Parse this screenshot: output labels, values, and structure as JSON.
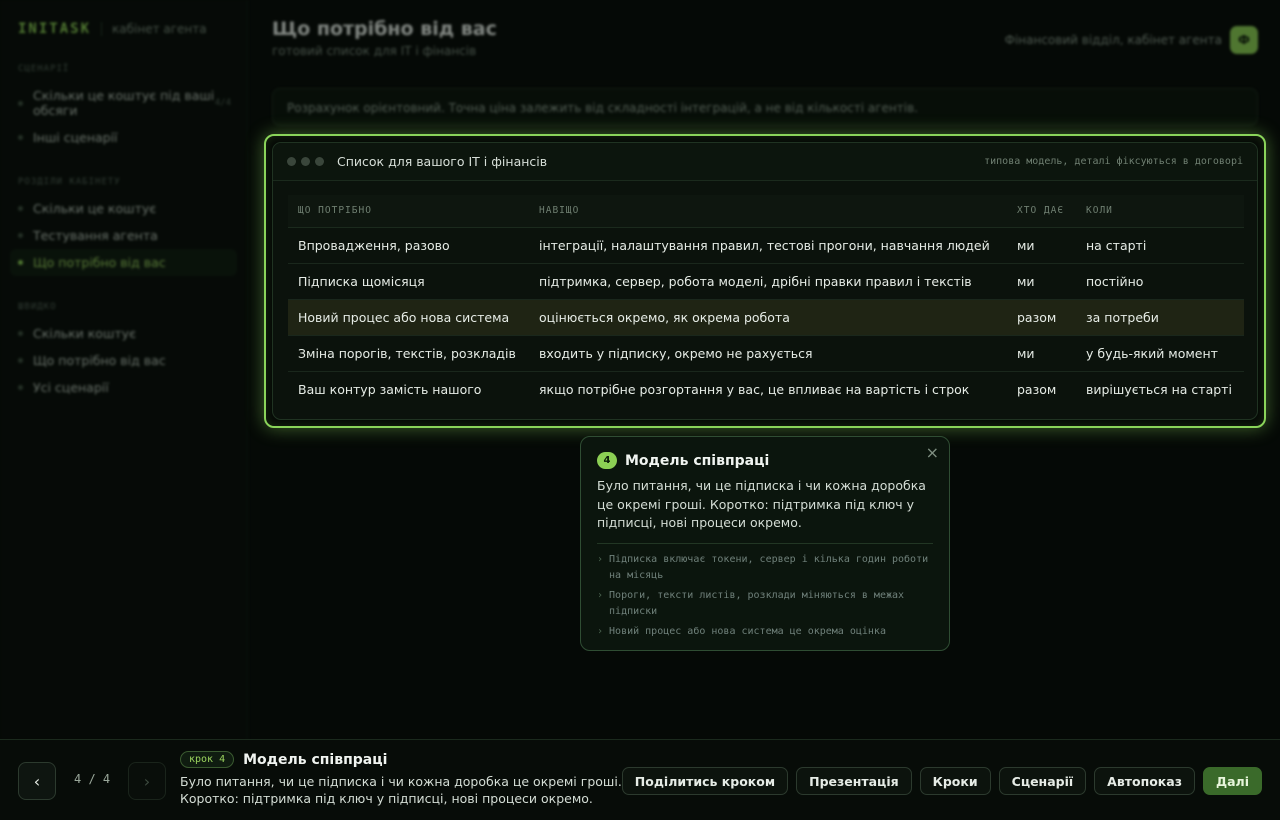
{
  "sidebar": {
    "brand": "INITASK",
    "brand_sub": "кабінет агента",
    "sections": [
      {
        "title": "СЦЕНАРІЇ",
        "items": [
          {
            "label": "Скільки це коштує під ваші обсяги",
            "count": "4/4"
          },
          {
            "label": "Інші сценарії",
            "count": ""
          }
        ]
      },
      {
        "title": "РОЗДІЛИ КАБІНЕТУ",
        "items": [
          {
            "label": "Скільки це коштує",
            "count": ""
          },
          {
            "label": "Тестування агента",
            "count": ""
          },
          {
            "label": "Що потрібно від вас",
            "count": ""
          }
        ]
      },
      {
        "title": "ШВИДКО",
        "items": [
          {
            "label": "Скільки коштує",
            "count": ""
          },
          {
            "label": "Що потрібно від вас",
            "count": ""
          },
          {
            "label": "Усі сценарії",
            "count": ""
          }
        ]
      }
    ]
  },
  "header": {
    "title": "Що потрібно від вас",
    "subtitle": "готовий список для IT і фінансів",
    "dept": "Фінансовий відділ, кабінет агента",
    "dept_button": "Ф"
  },
  "notice": "Розрахунок орієнтовний. Точна ціна залежить від складності інтеграцій, а не від кількості агентів.",
  "card": {
    "title": "Список для вашого IT і фінансів",
    "meta": "типова модель, деталі фіксуються в договорі",
    "columns": [
      "ЩО ПОТРІБНО",
      "НАВІЩО",
      "ХТО ДАЄ",
      "КОЛИ"
    ],
    "rows": [
      [
        "Впровадження, разово",
        "інтеграції, налаштування правил, тестові прогони, навчання людей",
        "ми",
        "на старті"
      ],
      [
        "Підписка щомісяця",
        "підтримка, сервер, робота моделі, дрібні правки правил і текстів",
        "ми",
        "постійно"
      ],
      [
        "Новий процес або нова система",
        "оцінюється окремо, як окрема робота",
        "разом",
        "за потреби"
      ],
      [
        "Зміна порогів, текстів, розкладів",
        "входить у підписку, окремо не рахується",
        "ми",
        "у будь-який момент"
      ],
      [
        "Ваш контур замість нашого",
        "якщо потрібне розгортання у вас, це впливає на вартість і строк",
        "разом",
        "вирішується на старті"
      ]
    ]
  },
  "popover": {
    "num": "4",
    "title": "Модель співпраці",
    "close": "×",
    "body": "Було питання, чи це підписка і чи кожна доробка це окремі гроші. Коротко: підтримка під ключ у підписці, нові процеси окремо.",
    "bullets": [
      "Підписка включає токени, сервер і кілька годин роботи на місяць",
      "Пороги, тексти листів, розклади міняються в межах підписки",
      "Новий процес або нова система це окрема оцінка"
    ]
  },
  "bottom": {
    "prev": "‹",
    "next": "›",
    "counter": "4 / 4",
    "badge": "крок 4",
    "title": "Модель співпраці",
    "desc": "Було питання, чи це підписка і чи кожна доробка це окремі гроші. Коротко: підтримка під ключ у підписці, нові процеси окремо.",
    "actions": {
      "share": "Поділитись кроком",
      "presentation": "Презентація",
      "steps": "Кроки",
      "scenarios": "Сценарії",
      "autoplay": "Автопоказ",
      "next": "Далі"
    }
  }
}
